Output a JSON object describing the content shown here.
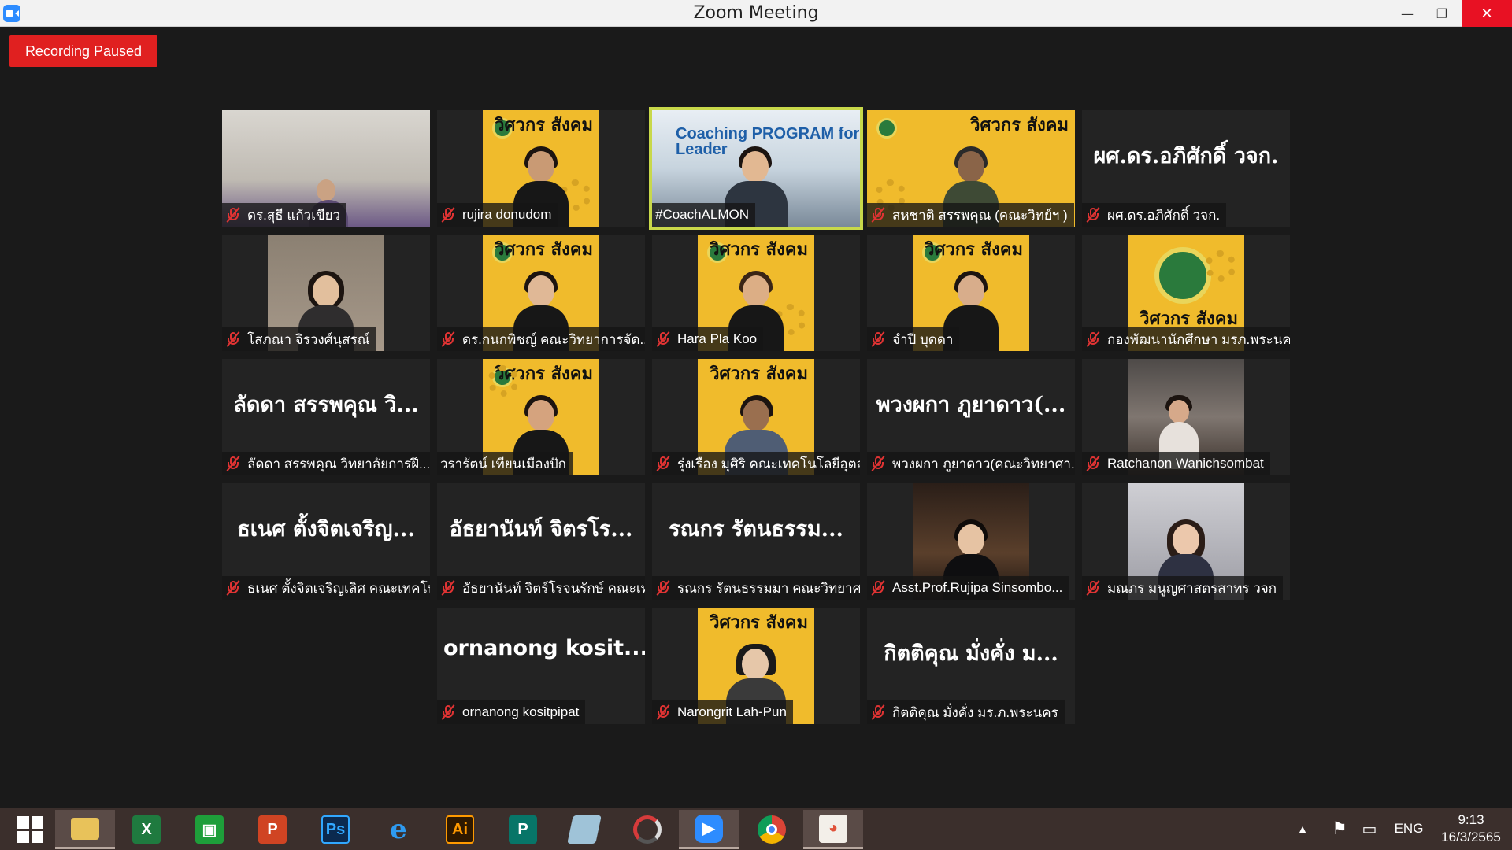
{
  "window": {
    "title": "Zoom Meeting",
    "minimize": "—",
    "maximize": "❐",
    "close": "✕"
  },
  "recording": {
    "label": "Recording Paused"
  },
  "participants": [
    {
      "name": "ดร.สุธี แก้วเขียว",
      "big_name": ""
    },
    {
      "name": "rujira donudom",
      "big_name": ""
    },
    {
      "name": "#CoachALMON",
      "big_name": "",
      "banner": "Coaching PROGRAM for Leader",
      "active_speaker": true
    },
    {
      "name": "สหชาติ สรรพคุณ (คณะวิทย์ฯ )",
      "big_name": ""
    },
    {
      "name": "ผศ.ดร.อภิศักดิ์ วจก.",
      "big_name": "ผศ.ดร.อภิศักดิ์ วจก."
    },
    {
      "name": "โสภณา จิรวงศ์นุสรณ์",
      "big_name": ""
    },
    {
      "name": "ดร.กนกพิชญ์ คณะวิทยาการจัด...",
      "big_name": ""
    },
    {
      "name": "Hara Pla Koo",
      "big_name": ""
    },
    {
      "name": "จำปี บุดดา",
      "big_name": ""
    },
    {
      "name": "กองพัฒนานักศึกษา มรภ.พระนคร",
      "big_name": ""
    },
    {
      "name": "ลัดดา สรรพคุณ วิทยาลัยการฝึ...",
      "big_name": "ลัดดา สรรพคุณ วิ..."
    },
    {
      "name": "วรารัตน์ เทียนเมืองปัก",
      "big_name": ""
    },
    {
      "name": "รุ่งเรือง มุศิริ คณะเทคโนโลยีอุตส...",
      "big_name": ""
    },
    {
      "name": "พวงผกา ภูยาดาว(คณะวิทยาศา...",
      "big_name": "พวงผกา ภูยาดาว(..."
    },
    {
      "name": "Ratchanon Wanichsombat",
      "big_name": ""
    },
    {
      "name": "ธเนศ ตั้งจิตเจริญเลิศ คณะเทคโน...",
      "big_name": "ธเนศ ตั้งจิตเจริญ..."
    },
    {
      "name": "อัธยานันท์ จิตร์โรจนรักษ์ คณะเท...",
      "big_name": "อัธยานันท์ จิตรโร..."
    },
    {
      "name": "รณกร รัตนธรรมมา คณะวิทยาศ...",
      "big_name": "รณกร รัตนธรรม..."
    },
    {
      "name": "Asst.Prof.Rujipa Sinsombo...",
      "big_name": ""
    },
    {
      "name": "มณภร มนูญศาสตรสาทร วจก",
      "big_name": ""
    },
    {
      "name": "ornanong kositpipat",
      "big_name": "ornanong kosit..."
    },
    {
      "name": "Narongrit Lah-Pun",
      "big_name": ""
    },
    {
      "name": "กิตติคุณ มั่งคั่ง มร.ภ.พระนคร",
      "big_name": "กิตติคุณ มั่งคั่ง ม..."
    }
  ],
  "poster_text": "วิศวกร สังคม",
  "taskbar": {
    "apps": [
      "start-menu",
      "file-explorer",
      "excel",
      "store",
      "powerpoint",
      "photoshop",
      "internet-explorer",
      "illustrator",
      "publisher",
      "notes",
      "photoscape",
      "zoom",
      "chrome",
      "paint"
    ],
    "photoshop_label": "Ps",
    "illustrator_label": "Ai",
    "excel_label": "X",
    "powerpoint_label": "P",
    "publisher_label": "P",
    "language": "ENG",
    "time": "9:13",
    "date": "16/3/2565"
  }
}
